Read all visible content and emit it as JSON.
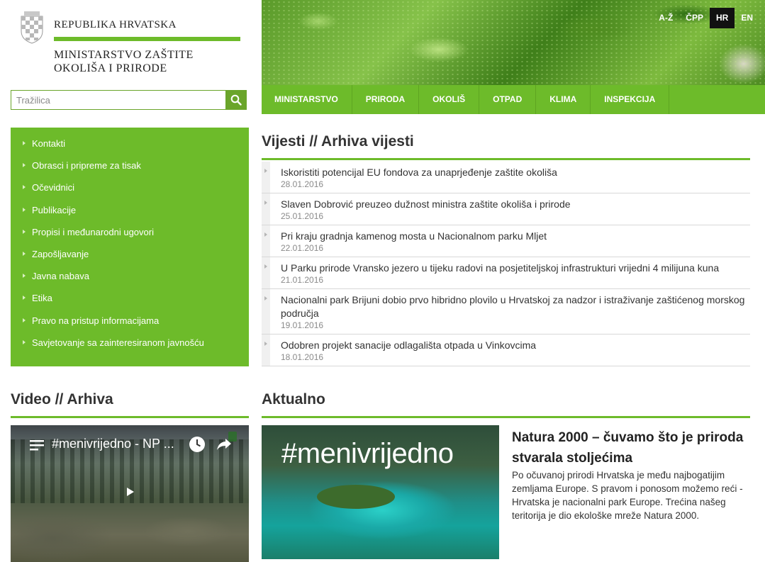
{
  "header": {
    "country": "REPUBLIKA HRVATSKA",
    "ministry_line1": "MINISTARSTVO ZAŠTITE",
    "ministry_line2": "OKOLIŠA I PRIRODE"
  },
  "search": {
    "placeholder": "Tražilica"
  },
  "languages": [
    {
      "label": "A-Ž",
      "active": false
    },
    {
      "label": "ČPP",
      "active": false
    },
    {
      "label": "HR",
      "active": true
    },
    {
      "label": "EN",
      "active": false
    }
  ],
  "topnav": [
    "MINISTARSTVO",
    "PRIRODA",
    "OKOLIŠ",
    "OTPAD",
    "KLIMA",
    "INSPEKCIJA"
  ],
  "sidebar": [
    "Kontakti",
    "Obrasci i pripreme za tisak",
    "Očevidnici",
    "Publikacije",
    "Propisi i međunarodni ugovori",
    "Zapošljavanje",
    "Javna nabava",
    "Etika",
    "Pravo na pristup informacijama",
    "Savjetovanje sa zainteresiranom javnošću"
  ],
  "news": {
    "title": "Vijesti // Arhiva vijesti",
    "items": [
      {
        "title": "Iskoristiti potencijal EU fondova za unaprjeđenje zaštite okoliša",
        "date": "28.01.2016"
      },
      {
        "title": "Slaven Dobrović preuzeo dužnost ministra zaštite okoliša i prirode",
        "date": "25.01.2016"
      },
      {
        "title": "Pri kraju gradnja kamenog mosta u Nacionalnom parku Mljet",
        "date": "22.01.2016"
      },
      {
        "title": "U Parku prirode Vransko jezero u tijeku radovi na posjetiteljskoj infrastrukturi vrijedni 4 milijuna kuna",
        "date": "21.01.2016"
      },
      {
        "title": "Nacionalni park Brijuni dobio prvo hibridno plovilo u Hrvatskoj za nadzor i istraživanje zaštićenog morskog područja",
        "date": "19.01.2016"
      },
      {
        "title": "Odobren projekt sanacije odlagališta otpada u Vinkovcima",
        "date": "18.01.2016"
      }
    ]
  },
  "video": {
    "section_title": "Video // Arhiva",
    "title": "#menivrijedno - NP ..."
  },
  "aktualno": {
    "section_title": "Aktualno",
    "image_text": "#menivrijedno",
    "headline": "Natura 2000 – čuvamo što je priroda stvarala stoljećima",
    "text": "Po očuvanoj prirodi Hrvatska je među najbogatijim zemljama Europe. S pravom i ponosom možemo reći - Hrvatska je nacionalni park Europe. Trećina našeg teritorija je dio ekološke mreže Natura 2000."
  },
  "colors": {
    "brand_green": "#6dbb2a",
    "text": "#333333",
    "date": "#8a8a8a"
  }
}
